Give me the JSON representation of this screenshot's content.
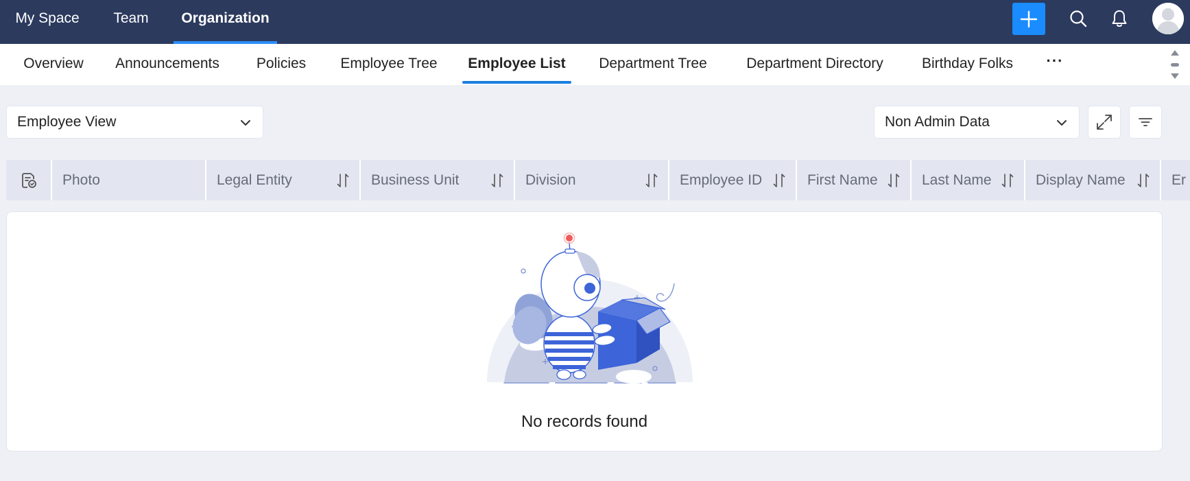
{
  "topnav": {
    "items": [
      {
        "label": "My Space"
      },
      {
        "label": "Team"
      },
      {
        "label": "Organization"
      }
    ],
    "active_index": 2
  },
  "subnav": {
    "tabs": [
      {
        "label": "Overview"
      },
      {
        "label": "Announcements"
      },
      {
        "label": "Policies"
      },
      {
        "label": "Employee Tree"
      },
      {
        "label": "Employee List"
      },
      {
        "label": "Department Tree"
      },
      {
        "label": "Department Directory"
      },
      {
        "label": "Birthday Folks"
      }
    ],
    "active_index": 4,
    "more_label": "···"
  },
  "toolbar": {
    "view_select": "Employee View",
    "data_select": "Non Admin Data"
  },
  "table": {
    "columns": [
      {
        "label": "Photo"
      },
      {
        "label": "Legal Entity"
      },
      {
        "label": "Business Unit"
      },
      {
        "label": "Division"
      },
      {
        "label": "Employee ID"
      },
      {
        "label": "First Name"
      },
      {
        "label": "Last Name"
      },
      {
        "label": "Display Name"
      },
      {
        "label": "Er"
      }
    ]
  },
  "empty_state": {
    "message": "No records found"
  },
  "colors": {
    "topbar": "#2c3a5e",
    "accent": "#1a8cff",
    "tab_underline": "#1a7ee0",
    "page_bg": "#eef0f5",
    "header_bg": "#e3e6f1"
  }
}
